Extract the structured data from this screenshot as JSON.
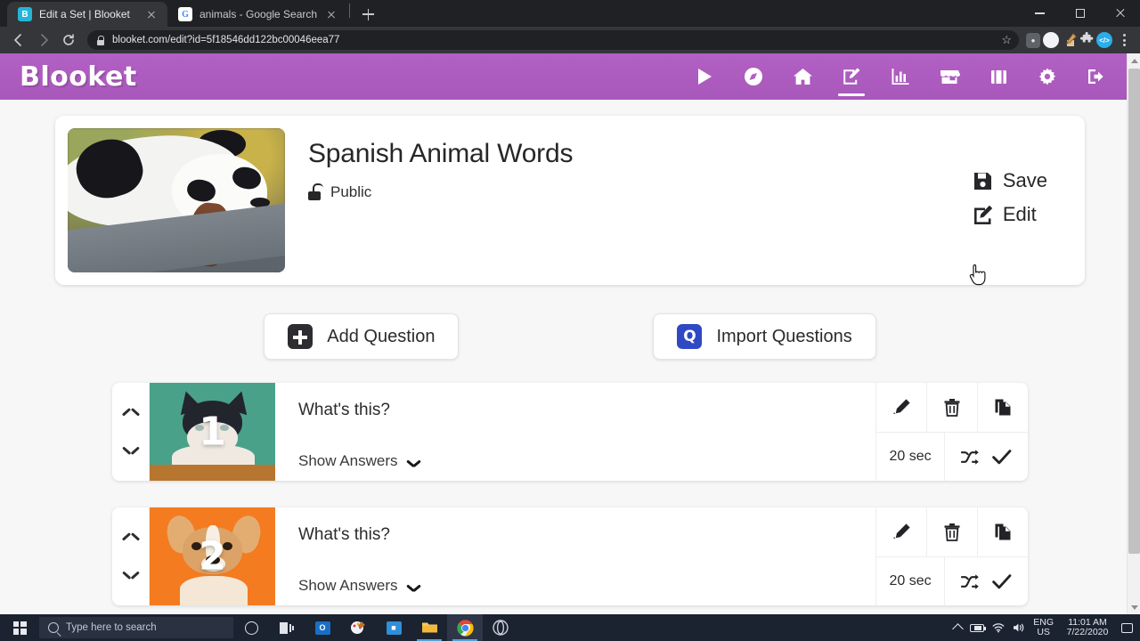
{
  "browser": {
    "tabs": [
      {
        "title": "Edit a Set | Blooket",
        "favicon": "B",
        "active": true
      },
      {
        "title": "animals - Google Search",
        "favicon": "G",
        "active": false
      }
    ],
    "new_tab_label": "+",
    "url": "blooket.com/edit?id=5f18546dd122bc00046eea77",
    "toolbar_icons": [
      "back-arrow-icon",
      "forward-arrow-icon",
      "reload-icon",
      "lock-icon",
      "bookmark-star-icon",
      "lastpass-icon",
      "profile-avatar-icon",
      "pencil-box-extension-icon",
      "puzzle-extension-icon",
      "code-extension-icon",
      "chrome-menu-icon"
    ],
    "window_controls": [
      "minimize",
      "maximize",
      "close"
    ]
  },
  "navbar": {
    "logo": "Blooket",
    "items": [
      {
        "name": "play",
        "icon": "play-icon",
        "active": false
      },
      {
        "name": "discover",
        "icon": "compass-icon",
        "active": false
      },
      {
        "name": "home",
        "icon": "home-icon",
        "active": false
      },
      {
        "name": "edit",
        "icon": "pen-square-icon",
        "active": true
      },
      {
        "name": "stats",
        "icon": "chart-icon",
        "active": false
      },
      {
        "name": "market",
        "icon": "store-icon",
        "active": false
      },
      {
        "name": "blooks",
        "icon": "briefcase-icon",
        "active": false
      },
      {
        "name": "settings",
        "icon": "gear-icon",
        "active": false
      },
      {
        "name": "logout",
        "icon": "sign-out-icon",
        "active": false
      }
    ]
  },
  "set": {
    "title": "Spanish Animal Words",
    "visibility": "Public",
    "visibility_icon": "unlock-icon",
    "cover_image_alt": "panda",
    "save_label": "Save",
    "save_icon": "floppy-disk-icon",
    "edit_label": "Edit",
    "edit_icon": "pen-square-icon"
  },
  "actions": {
    "add_question": "Add Question",
    "add_question_icon": "plus-square-icon",
    "import_questions": "Import Questions",
    "import_questions_icon": "quizlet-q-icon",
    "import_icon_color": "#2f49c4"
  },
  "questions": [
    {
      "number": "1",
      "text": "What's this?",
      "show_answers": "Show Answers",
      "time": "20 sec",
      "thumb": "cat",
      "thumb_color": "#4aa189",
      "buttons": [
        "pencil-icon",
        "trash-icon",
        "copy-icon",
        "shuffle-icon",
        "check-icon"
      ]
    },
    {
      "number": "2",
      "text": "What's this?",
      "show_answers": "Show Answers",
      "time": "20 sec",
      "thumb": "dog",
      "thumb_color": "#f47b20",
      "buttons": [
        "pencil-icon",
        "trash-icon",
        "copy-icon",
        "shuffle-icon",
        "check-icon"
      ]
    }
  ],
  "taskbar": {
    "search_placeholder": "Type here to search",
    "apps": [
      "cortana-icon",
      "task-view-icon",
      "outlook-icon",
      "paint-icon",
      "store-icon",
      "file-explorer-icon",
      "chrome-icon",
      "opera-icon"
    ],
    "language": "ENG",
    "region": "US",
    "time": "11:01 AM",
    "date": "7/22/2020"
  }
}
